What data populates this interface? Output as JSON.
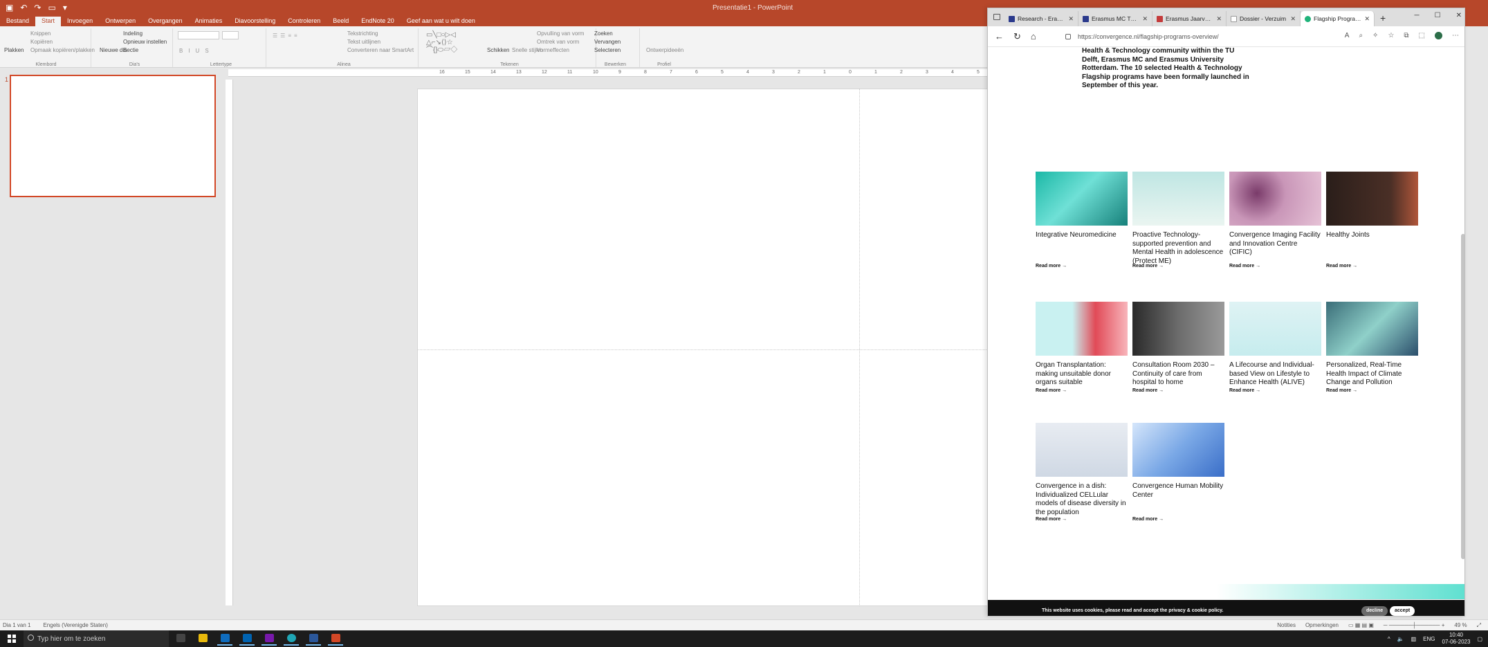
{
  "ppt": {
    "title": "Presentatie1 - PowerPoint",
    "tabs": [
      "Bestand",
      "Start",
      "Invoegen",
      "Ontwerpen",
      "Overgangen",
      "Animaties",
      "Diavoorstelling",
      "Controleren",
      "Beeld",
      "EndNote 20",
      "Geef aan wat u wilt doen"
    ],
    "ribbon": {
      "plakken": "Plakken",
      "knippen": "Knippen",
      "kopieren": "Kopiëren",
      "opmaak": "Opmaak kopiëren/plakken",
      "klembord": "Klembord",
      "nieuwe_dia": "Nieuwe dia",
      "indeling": "Indeling",
      "opnieuw": "Opnieuw instellen",
      "sectie": "Sectie",
      "dias": "Dia's",
      "lettertype": "Lettertype",
      "alinea": "Alinea",
      "tekstrichting": "Tekstrichting",
      "tekst_uitlijnen": "Tekst uitlijnen",
      "smartart": "Converteren naar SmartArt",
      "tekenen": "Tekenen",
      "schikken": "Schikken",
      "snelle_stijlen": "Snelle stijlen",
      "opvulling": "Opvulling van vorm",
      "omtrek": "Omtrek van vorm",
      "vormeffecten": "Vormeffecten",
      "zoeken": "Zoeken",
      "vervangen": "Vervangen",
      "selecteren": "Selecteren",
      "bewerken": "Bewerken",
      "ontwerpideeen": "Ontwerpideeën",
      "profiel": "Profiel"
    },
    "slide_number": "1",
    "ruler_ticks": [
      "16",
      "15",
      "14",
      "13",
      "12",
      "11",
      "10",
      "9",
      "8",
      "7",
      "6",
      "5",
      "4",
      "3",
      "2",
      "1",
      "0",
      "1",
      "2",
      "3",
      "4",
      "5"
    ],
    "status_left": [
      "Dia 1 van 1",
      "Engels (Verenigde Staten)"
    ],
    "status_right": [
      "Notities",
      "Opmerkingen",
      "49 %"
    ]
  },
  "edge": {
    "tabs": [
      {
        "label": "Research - Erasmus",
        "color": "#2b3a8c"
      },
      {
        "label": "Erasmus MC TKI-LSH",
        "color": "#2b3a8c"
      },
      {
        "label": "Erasmus Jaarverslag",
        "color": "#c43b3b"
      },
      {
        "label": "Dossier - Verzuim",
        "color": "#ffffff"
      },
      {
        "label": "Flagship Programs",
        "color": "#1fb37a"
      }
    ],
    "url": "https://convergence.nl/flagship-programs-overview/",
    "intro": "Health & Technology community within the TU Delft, Erasmus MC and Erasmus University Rotterdam. The 10 selected Health & Technology Flagship programs have been formally launched in September of this year.",
    "read_more": "Read more",
    "cards": [
      {
        "title": "Integrative Neuromedicine",
        "bg": "linear-gradient(135deg,#1bb8a6,#6fe0d6 45%,#16807a)"
      },
      {
        "title": "Proactive Technology-supported prevention and Mental Health in adolescence (Protect ME)",
        "bg": "linear-gradient(180deg,#bfe6e3,#eaf5f1)"
      },
      {
        "title": "Convergence Imaging Facility and Innovation Centre (CIFIC)",
        "bg": "radial-gradient(circle at 30% 40%,#7a3b6a,#c996b8 40%,#e6c2d6)"
      },
      {
        "title": "Healthy Joints",
        "bg": "linear-gradient(90deg,#2a1e1a,#4a2f26 70%,#b0563a)"
      },
      {
        "title": "Organ Transplantation: making unsuitable donor organs suitable",
        "bg": "linear-gradient(90deg,#c9f1f1 40%,#e14a57 65%,#f8b5bb)"
      },
      {
        "title": "Consultation Room 2030 – Continuity of care from hospital to home",
        "bg": "linear-gradient(90deg,#2a2a2a,#6c6c6c 50%,#9a9a9a)"
      },
      {
        "title": "A Lifecourse and Individual-based View on Lifestyle to Enhance Health (ALIVE)",
        "bg": "linear-gradient(180deg,#dff3f4,#c6ecee)"
      },
      {
        "title": "Personalized, Real-Time Health Impact of Climate Change and Pollution",
        "bg": "linear-gradient(135deg,#3a6d78,#8fd0c9 50%,#2b4e6b)"
      },
      {
        "title": "Convergence in a dish: Individualized CELLular models of disease diversity in the population",
        "bg": "linear-gradient(180deg,#e8ecf2,#cfd8e4)"
      },
      {
        "title": "Convergence Human Mobility Center",
        "bg": "linear-gradient(135deg,#d5e6fb,#7aa8e6 50%,#3a6ec8)"
      }
    ],
    "cookie_text": "This website uses cookies, please read and accept the privacy & cookie policy.",
    "decline": "decline",
    "accept": "accept"
  },
  "taskbar": {
    "search_placeholder": "Typ hier om te zoeken",
    "apps": [
      {
        "name": "task-view",
        "color": "#444"
      },
      {
        "name": "file-explorer",
        "color": "#e8b90c"
      },
      {
        "name": "outlook",
        "color": "#0f6cbd"
      },
      {
        "name": "calculator",
        "color": "#0063b1"
      },
      {
        "name": "onenote",
        "color": "#7719aa"
      },
      {
        "name": "edge",
        "color": "#1fa6b5"
      },
      {
        "name": "word",
        "color": "#2b579a"
      },
      {
        "name": "powerpoint",
        "color": "#d24726"
      }
    ],
    "lang": "ENG",
    "time": "10:40",
    "date": "07-06-2023"
  }
}
